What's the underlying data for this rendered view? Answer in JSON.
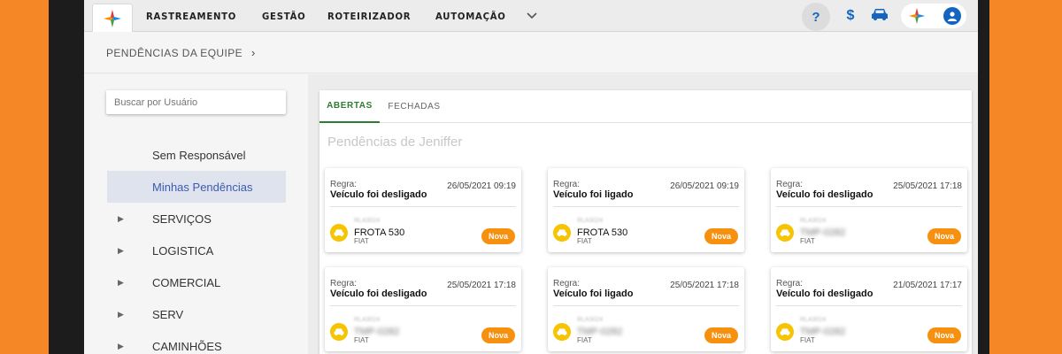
{
  "colors": {
    "background": "#f58726",
    "accent_green": "#2e7d32",
    "link_blue": "#1565c0",
    "badge_orange": "#f7900f",
    "vehicle_yellow": "#f6c400"
  },
  "nav": {
    "items": [
      {
        "label": "RASTREAMENTO"
      },
      {
        "label": "GESTÃO"
      },
      {
        "label": "ROTEIRIZADOR"
      },
      {
        "label": "AUTOMAÇÃO"
      }
    ],
    "more_icon": "chevron-down-icon",
    "help_label": "?",
    "dollar_label": "$"
  },
  "breadcrumb": {
    "label": "PENDÊNCIAS DA EQUIPE",
    "chevron": "›"
  },
  "search": {
    "placeholder": "Buscar por Usuário"
  },
  "sidebar": {
    "items": [
      {
        "label": "Sem Responsável",
        "arrow": ""
      },
      {
        "label": "Minhas Pendências",
        "arrow": ""
      },
      {
        "label": "SERVIÇOS",
        "arrow": "▶"
      },
      {
        "label": "LOGISTICA",
        "arrow": "▶"
      },
      {
        "label": "COMERCIAL",
        "arrow": "▶"
      },
      {
        "label": "SERV",
        "arrow": "▶"
      },
      {
        "label": "CAMINHÕES",
        "arrow": "▶"
      }
    ]
  },
  "tabs": [
    {
      "label": "ABERTAS"
    },
    {
      "label": "FECHADAS"
    }
  ],
  "panel_title": "Pendências de Jeniffer",
  "cards": [
    {
      "rule_label": "Regra:",
      "rule": "Veículo foi desligado",
      "date": "26/05/2021 09:19",
      "plate": "RLA3024",
      "vehicle": "FROTA 530",
      "vehicle_blurred": false,
      "make": "FIAT",
      "status": "Nova"
    },
    {
      "rule_label": "Regra:",
      "rule": "Veículo foi ligado",
      "date": "26/05/2021 09:19",
      "plate": "RLA3024",
      "vehicle": "FROTA 530",
      "vehicle_blurred": false,
      "make": "FIAT",
      "status": "Nova"
    },
    {
      "rule_label": "Regra:",
      "rule": "Veículo foi desligado",
      "date": "25/05/2021 17:18",
      "plate": "RLA3024",
      "vehicle": "TMP-0282",
      "vehicle_blurred": true,
      "make": "FIAT",
      "status": "Nova"
    },
    {
      "rule_label": "Regra:",
      "rule": "Veículo foi desligado",
      "date": "25/05/2021 17:18",
      "plate": "RLA3024",
      "vehicle": "TMP-0282",
      "vehicle_blurred": true,
      "make": "FIAT",
      "status": "Nova"
    },
    {
      "rule_label": "Regra:",
      "rule": "Veículo foi ligado",
      "date": "25/05/2021 17:18",
      "plate": "RLA3024",
      "vehicle": "TMP-0282",
      "vehicle_blurred": true,
      "make": "FIAT",
      "status": "Nova"
    },
    {
      "rule_label": "Regra:",
      "rule": "Veículo foi desligado",
      "date": "21/05/2021 17:17",
      "plate": "RLA3024",
      "vehicle": "TMP-0282",
      "vehicle_blurred": true,
      "make": "FIAT",
      "status": "Nova"
    }
  ]
}
